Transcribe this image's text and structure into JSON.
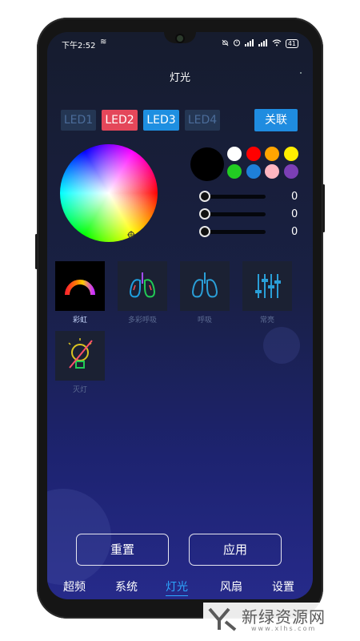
{
  "status_bar": {
    "time": "下午2:52",
    "battery": "41"
  },
  "header": {
    "title": "灯光"
  },
  "led_tabs": [
    {
      "label": "LED1",
      "state": "off"
    },
    {
      "label": "LED2",
      "state": "red"
    },
    {
      "label": "LED3",
      "state": "blue"
    },
    {
      "label": "LED4",
      "state": "off"
    }
  ],
  "link_button": "关联",
  "color_picker": {
    "preview_color": "#000000",
    "swatches": [
      "#ffffff",
      "#ff0000",
      "#ffa500",
      "#ffee00",
      "#22cc22",
      "#1e7fd8",
      "#ffb6c1",
      "#7b3fb5"
    ]
  },
  "sliders": [
    {
      "value": "0"
    },
    {
      "value": "0"
    },
    {
      "value": "0"
    }
  ],
  "modes": [
    {
      "label": "彩虹",
      "icon": "rainbow-icon",
      "active": true
    },
    {
      "label": "多彩呼吸",
      "icon": "colorful-lungs-icon",
      "active": false
    },
    {
      "label": "呼吸",
      "icon": "lungs-icon",
      "active": false
    },
    {
      "label": "常亮",
      "icon": "equalizer-icon",
      "active": false
    },
    {
      "label": "灭灯",
      "icon": "bulb-off-icon",
      "active": false
    }
  ],
  "actions": {
    "reset": "重置",
    "apply": "应用"
  },
  "bottom_nav": [
    {
      "label": "超频",
      "active": false
    },
    {
      "label": "系统",
      "active": false
    },
    {
      "label": "灯光",
      "active": true
    },
    {
      "label": "风扇",
      "active": false
    },
    {
      "label": "设置",
      "active": false
    }
  ],
  "watermark": {
    "text": "新绿资源网",
    "url": "www.xlhs.com"
  }
}
